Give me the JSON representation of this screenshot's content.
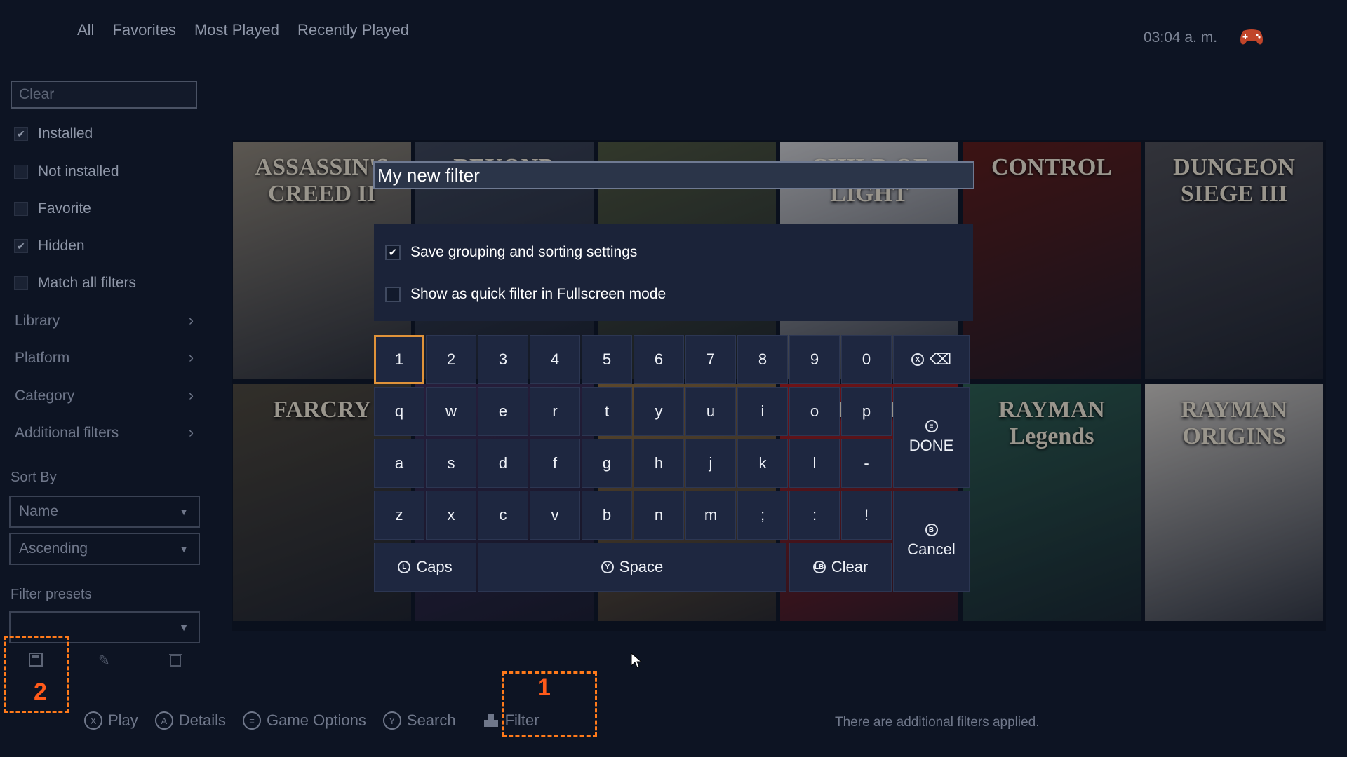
{
  "topnav": {
    "items": [
      "All",
      "Favorites",
      "Most Played",
      "Recently Played"
    ]
  },
  "clock": "03:04 a. m.",
  "sidebar": {
    "search_placeholder": "Clear",
    "checks": [
      {
        "label": "Installed",
        "checked": true
      },
      {
        "label": "Not installed",
        "checked": false
      },
      {
        "label": "Favorite",
        "checked": false
      },
      {
        "label": "Hidden",
        "checked": true
      },
      {
        "label": "Match all filters",
        "checked": false
      }
    ],
    "menus": [
      "Library",
      "Platform",
      "Category",
      "Additional filters"
    ],
    "sort_label": "Sort By",
    "sort_by": "Name",
    "sort_order": "Ascending",
    "presets_label": "Filter presets",
    "preset_value": ""
  },
  "games": [
    {
      "title": "ASSASSIN'S CREED II",
      "color": "#8a8272"
    },
    {
      "title": "BEYOND",
      "color": "#3a4252"
    },
    {
      "title": "",
      "color": "#4a5238"
    },
    {
      "title": "CHILD OF LIGHT",
      "color": "#c8c8c8"
    },
    {
      "title": "CONTROL",
      "color": "#5a1a14"
    },
    {
      "title": "DUNGEON SIEGE III",
      "color": "#4a4a4e"
    },
    {
      "title": "FARCRY",
      "color": "#4a4436"
    },
    {
      "title": "",
      "color": "#3a2a52"
    },
    {
      "title": "",
      "color": "#8a6a3a"
    },
    {
      "title": "EDGE",
      "color": "#a81a1a"
    },
    {
      "title": "RAYMAN Legends",
      "color": "#2a5a4a"
    },
    {
      "title": "RAYMAN ORIGINS",
      "color": "#c8c4bc"
    }
  ],
  "dialog": {
    "filter_name": "My  new  filter",
    "option_save": "Save grouping and sorting settings",
    "option_save_checked": true,
    "option_quick": "Show as quick filter in Fullscreen mode",
    "option_quick_checked": false
  },
  "keyboard": {
    "row1": [
      "1",
      "2",
      "3",
      "4",
      "5",
      "6",
      "7",
      "8",
      "9",
      "0"
    ],
    "row2": [
      "q",
      "w",
      "e",
      "r",
      "t",
      "y",
      "u",
      "i",
      "o",
      "p"
    ],
    "row3": [
      "a",
      "s",
      "d",
      "f",
      "g",
      "h",
      "j",
      "k",
      "l",
      "-"
    ],
    "row4": [
      "z",
      "x",
      "c",
      "v",
      "b",
      "n",
      "m",
      ";",
      ":",
      "!"
    ],
    "backspace": "⌫",
    "done": "DONE",
    "cancel": "Cancel",
    "caps": "Caps",
    "space": "Space",
    "clear": "Clear"
  },
  "bottom": {
    "hints": [
      {
        "glyph": "X",
        "label": "Play"
      },
      {
        "glyph": "A",
        "label": "Details"
      },
      {
        "glyph": "≡",
        "label": "Game Options"
      },
      {
        "glyph": "Y",
        "label": "Search"
      }
    ],
    "filter_label": "Filter",
    "notice": "There are additional filters applied."
  },
  "annotations": {
    "one": "1",
    "two": "2"
  },
  "colors": {
    "accent": "#e0933a",
    "annotation": "#ff7a1a",
    "background": "#0d1423"
  }
}
